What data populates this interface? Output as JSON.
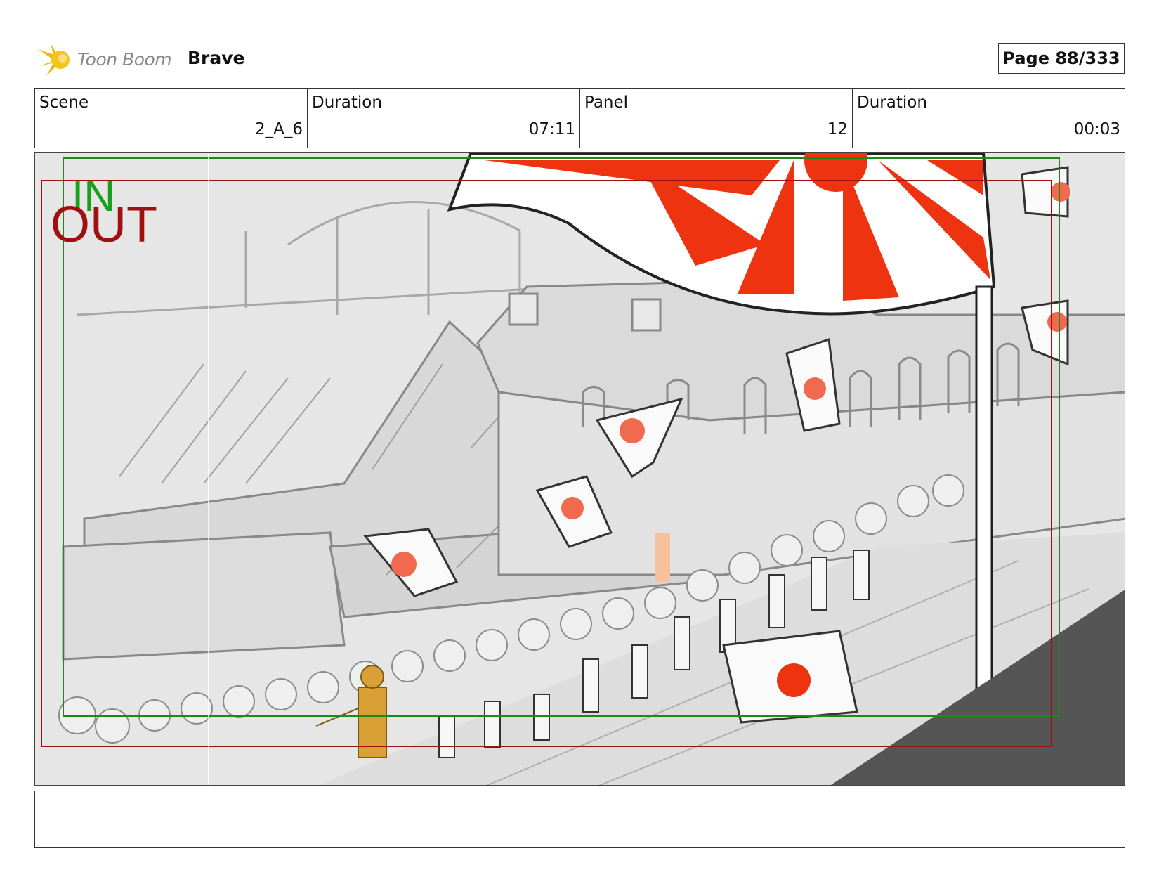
{
  "header": {
    "logo_text": "Toon Boom",
    "project_title": "Brave",
    "page_label": "Page 88/333"
  },
  "info": {
    "scene_label": "Scene",
    "scene_value": "2_A_6",
    "scene_duration_label": "Duration",
    "scene_duration_value": "07:11",
    "panel_label": "Panel",
    "panel_value": "12",
    "panel_duration_label": "Duration",
    "panel_duration_value": "00:03"
  },
  "panel": {
    "in_label": "IN",
    "out_label": "OUT",
    "colors": {
      "in_frame": "#1a8a1a",
      "out_frame": "#a01010",
      "flag_red": "#ee3311",
      "flag_disc": "#f06a50",
      "sketch_gray": "#8a8a8a"
    }
  },
  "notes": {
    "text": ""
  }
}
